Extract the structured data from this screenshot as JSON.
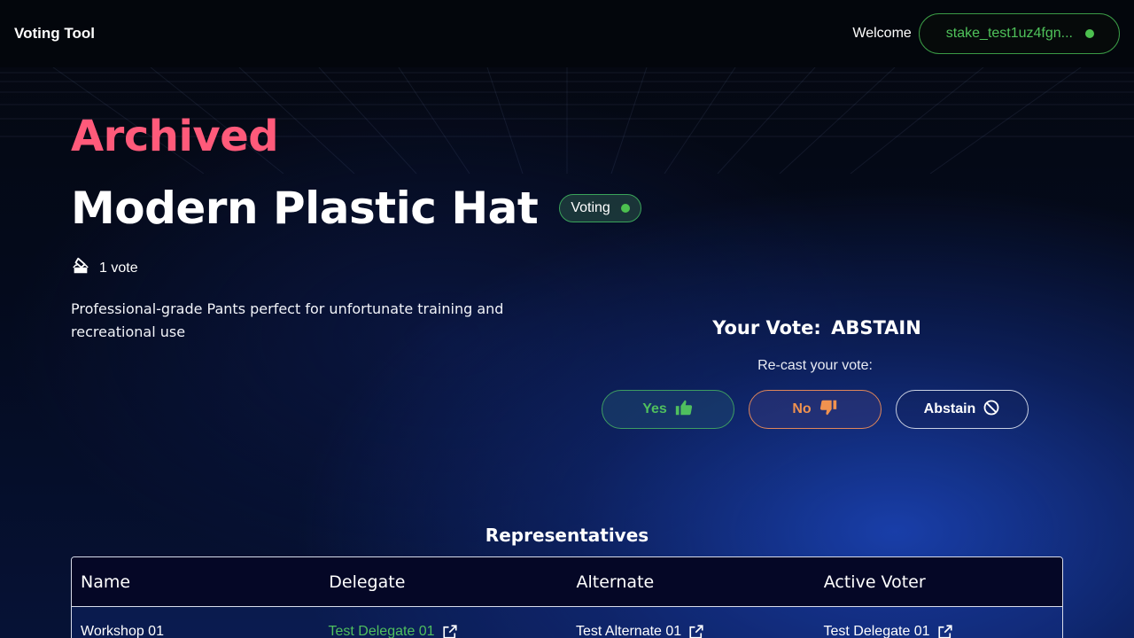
{
  "header": {
    "brand": "Voting Tool",
    "welcome": "Welcome",
    "wallet_address": "stake_test1uz4fgn...",
    "wallet_status_color": "#4cc04f"
  },
  "proposal": {
    "state": "Archived",
    "title": "Modern Plastic Hat",
    "status_label": "Voting",
    "vote_count": "1 vote",
    "description": "Professional-grade Pants perfect for unfortunate training and recreational use"
  },
  "vote": {
    "label": "Your Vote:",
    "value": "ABSTAIN",
    "recast_prompt": "Re-cast your vote:",
    "buttons": {
      "yes": "Yes",
      "no": "No",
      "abstain": "Abstain"
    }
  },
  "representatives": {
    "title": "Representatives",
    "columns": [
      "Name",
      "Delegate",
      "Alternate",
      "Active Voter"
    ],
    "rows": [
      {
        "name": "Workshop 01",
        "delegate": "Test Delegate 01",
        "alternate": "Test Alternate 01",
        "active_voter": "Test Delegate 01"
      }
    ]
  },
  "colors": {
    "archived": "#ff5a7a",
    "yes": "#4fbf5e",
    "no": "#f0924f",
    "accent_green": "#4cc04f"
  },
  "icons": {
    "votes": "ballot-box-icon",
    "yes": "thumbs-up-icon",
    "no": "thumbs-down-icon",
    "abstain": "prohibited-icon",
    "link": "external-link-icon"
  }
}
